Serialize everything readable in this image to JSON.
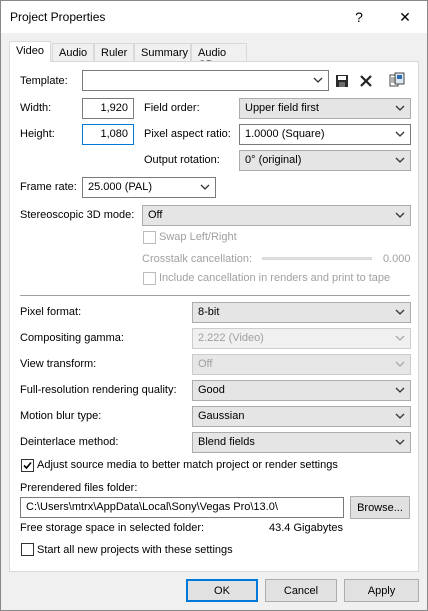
{
  "window": {
    "title": "Project Properties",
    "help_glyph": "?",
    "close_glyph": "✕"
  },
  "tabs": [
    {
      "label": "Video"
    },
    {
      "label": "Audio"
    },
    {
      "label": "Ruler"
    },
    {
      "label": "Summary"
    },
    {
      "label": "Audio CD"
    }
  ],
  "video": {
    "template_label": "Template:",
    "template_value": "",
    "width_label": "Width:",
    "width_value": "1,920",
    "height_label": "Height:",
    "height_value": "1,080",
    "field_order_label": "Field order:",
    "field_order_value": "Upper field first",
    "pixel_aspect_label": "Pixel aspect ratio:",
    "pixel_aspect_value": "1.0000 (Square)",
    "output_rotation_label": "Output rotation:",
    "output_rotation_value": "0° (original)",
    "frame_rate_label": "Frame rate:",
    "frame_rate_value": "25.000 (PAL)",
    "stereo_label": "Stereoscopic 3D mode:",
    "stereo_value": "Off",
    "swap_label": "Swap Left/Right",
    "crosstalk_label": "Crosstalk cancellation:",
    "crosstalk_value": "0.000",
    "include_cancel_label": "Include cancellation in renders and print to tape",
    "pixel_format_label": "Pixel format:",
    "pixel_format_value": "8-bit",
    "compositing_label": "Compositing gamma:",
    "compositing_value": "2.222 (Video)",
    "view_transform_label": "View transform:",
    "view_transform_value": "Off",
    "fullres_label": "Full-resolution rendering quality:",
    "fullres_value": "Good",
    "motion_blur_label": "Motion blur type:",
    "motion_blur_value": "Gaussian",
    "deinterlace_label": "Deinterlace method:",
    "deinterlace_value": "Blend fields",
    "adjust_label": "Adjust source media to better match project or render settings",
    "adjust_checked": true,
    "prerendered_label": "Prerendered files folder:",
    "prerendered_value": "C:\\Users\\mtrx\\AppData\\Local\\Sony\\Vegas Pro\\13.0\\",
    "browse_label": "Browse...",
    "free_space_label": "Free storage space in selected folder:",
    "free_space_value": "43.4 Gigabytes",
    "start_all_label": "Start all new projects with these settings",
    "start_all_checked": false
  },
  "footer": {
    "ok_label": "OK",
    "cancel_label": "Cancel",
    "apply_label": "Apply"
  },
  "colors": {
    "accent": "#0078d7",
    "disabled_text": "#a0a0a0"
  }
}
